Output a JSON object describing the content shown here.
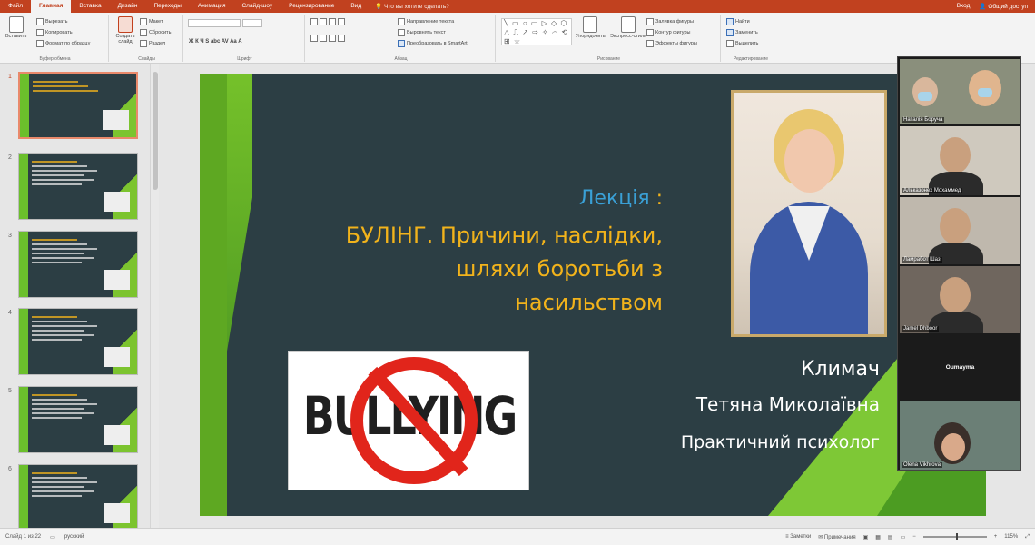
{
  "menu": {
    "tabs": [
      "Файл",
      "Главная",
      "Вставка",
      "Дизайн",
      "Переходы",
      "Анимация",
      "Слайд-шоу",
      "Рецензирование",
      "Вид"
    ],
    "active_tab": "Главная",
    "tell_me": "Что вы хотите сделать?",
    "login": "Вход",
    "share": "Общий доступ"
  },
  "ribbon": {
    "clipboard": {
      "paste": "Вставить",
      "cut": "Вырезать",
      "copy": "Копировать",
      "format_painter": "Формат по образцу",
      "group": "Буфер обмена"
    },
    "slides": {
      "new_slide": "Создать слайд",
      "layout": "Макет",
      "reset": "Сбросить",
      "section": "Раздел",
      "group": "Слайды"
    },
    "font": {
      "group": "Шрифт",
      "format_row": "Ж  К  Ч  S  abc  AV  Aa  A"
    },
    "paragraph": {
      "text_direction": "Направление текста",
      "align_text": "Выровнять текст",
      "smartart": "Преобразовать в SmartArt",
      "group": "Абзац"
    },
    "drawing": {
      "shape_glyphs": "╲ ▭ ○ ▭ ▷ ◇ ⬡ △ ⎍ ↗ ⇨ ✧ ⌒ ⟲ ⊞ ☆",
      "arrange": "Упорядочить",
      "quick_styles": "Экспресс-стили",
      "fill": "Заливка фигуры",
      "outline": "Контур фигуры",
      "effects": "Эффекты фигуры",
      "group": "Рисование"
    },
    "editing": {
      "find": "Найти",
      "replace": "Заменить",
      "select": "Выделить",
      "group": "Редактирование"
    }
  },
  "thumbnails": [
    {
      "num": "1"
    },
    {
      "num": "2"
    },
    {
      "num": "3"
    },
    {
      "num": "4"
    },
    {
      "num": "5"
    },
    {
      "num": "6"
    }
  ],
  "slide": {
    "lecture": "Лекція",
    "colon": ":",
    "title_lines": [
      "БУЛІНГ. Причини, наслідки,",
      "шляхи боротьби з",
      "насильством"
    ],
    "bullying_text": "BULLYING",
    "author_surname": "Климач",
    "author_name": "Тетяна Миколаївна",
    "author_role": "Практичний психолог"
  },
  "participants": [
    {
      "name": "Наталія Боруча",
      "bg": "#8a8f7c"
    },
    {
      "name": "Альказонех Мохаммед",
      "bg": "#cfc9be"
    },
    {
      "name": "Ламработ Шаз",
      "bg": "#bfb8ad"
    },
    {
      "name": "Jamel Dhboor",
      "bg": "#6f665e"
    },
    {
      "name": "Oumayma",
      "bg": "#1b1b1b"
    },
    {
      "name": "Olena Vikhrova",
      "bg": "#6b7f76"
    }
  ],
  "status": {
    "slide_info": "Слайд 1 из 22",
    "language": "русский",
    "notes": "Заметки",
    "comments": "Примечания",
    "zoom": "115%"
  }
}
